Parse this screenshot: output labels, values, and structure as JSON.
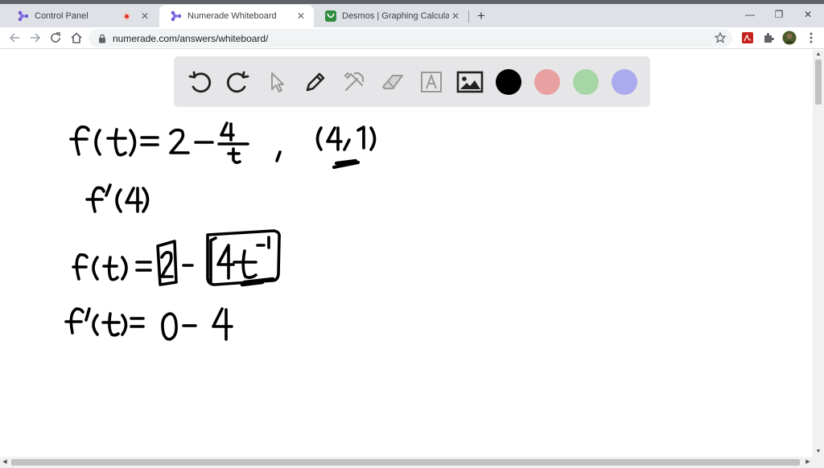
{
  "browser": {
    "tabs": [
      {
        "title": "Control Panel",
        "active": false,
        "recording": true
      },
      {
        "title": "Numerade Whiteboard",
        "active": true,
        "recording": false
      },
      {
        "title": "Desmos | Graphing Calculator",
        "active": false,
        "recording": false
      }
    ],
    "url": "numerade.com/answers/whiteboard/"
  },
  "whiteboard": {
    "tools": [
      "undo-icon",
      "redo-icon",
      "pointer-icon",
      "pen-icon",
      "tools-icon",
      "eraser-icon",
      "text-icon",
      "image-icon"
    ],
    "colors": [
      "#000000",
      "#e8a0a0",
      "#a6d6a6",
      "#aaaaee"
    ]
  },
  "colors": {
    "tabstrip": "#dee1e6",
    "ink": "#000000"
  }
}
